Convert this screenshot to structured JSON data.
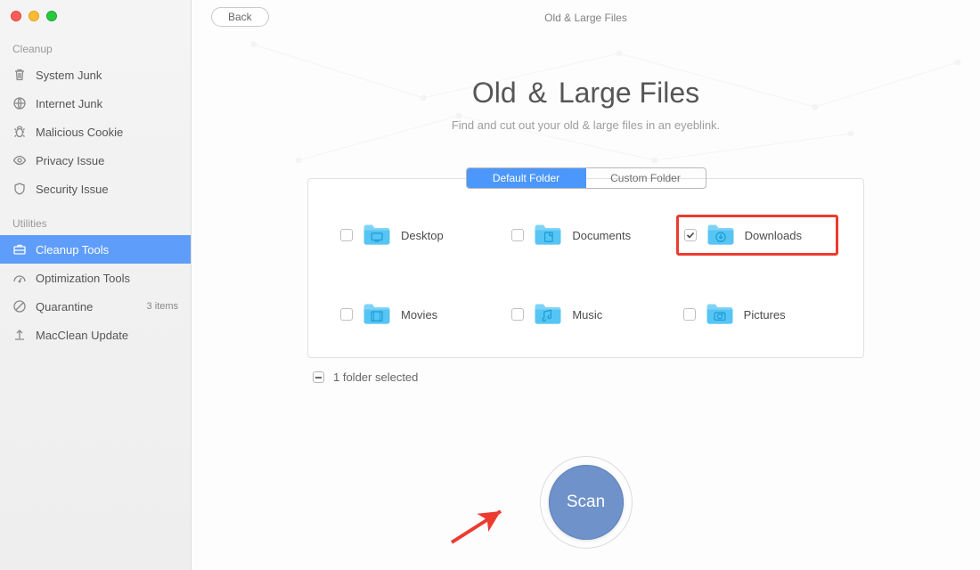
{
  "header": {
    "back_label": "Back",
    "window_title": "Old & Large Files"
  },
  "sidebar": {
    "sections": {
      "cleanup_label": "Cleanup",
      "utilities_label": "Utilities"
    },
    "cleanup": [
      {
        "icon": "trash",
        "label": "System Junk"
      },
      {
        "icon": "globe",
        "label": "Internet Junk"
      },
      {
        "icon": "bug",
        "label": "Malicious Cookie"
      },
      {
        "icon": "eye",
        "label": "Privacy Issue"
      },
      {
        "icon": "shield",
        "label": "Security Issue"
      }
    ],
    "utilities": [
      {
        "icon": "briefcase",
        "label": "Cleanup Tools",
        "active": true
      },
      {
        "icon": "gauge",
        "label": "Optimization Tools"
      },
      {
        "icon": "quarantine",
        "label": "Quarantine",
        "badge": "3 items"
      },
      {
        "icon": "upload",
        "label": "MacClean Update"
      }
    ]
  },
  "hero": {
    "title_pre": "Old ",
    "title_amp": "&",
    "title_post": " Large Files",
    "subtitle": "Find and cut out your old & large files in an eyeblink."
  },
  "tabs": {
    "default": "Default Folder",
    "custom": "Custom Folder"
  },
  "folders": [
    {
      "name": "Desktop",
      "icon": "desktop",
      "checked": false,
      "highlight": false
    },
    {
      "name": "Documents",
      "icon": "documents",
      "checked": false,
      "highlight": false
    },
    {
      "name": "Downloads",
      "icon": "downloads",
      "checked": true,
      "highlight": true
    },
    {
      "name": "Movies",
      "icon": "movies",
      "checked": false,
      "highlight": false
    },
    {
      "name": "Music",
      "icon": "music",
      "checked": false,
      "highlight": false
    },
    {
      "name": "Pictures",
      "icon": "pictures",
      "checked": false,
      "highlight": false
    }
  ],
  "selection": {
    "text": "1 folder selected"
  },
  "scan": {
    "label": "Scan"
  },
  "colors": {
    "accent": "#4c97fb",
    "highlight": "#ec3b2f",
    "scan": "#6e92c9"
  }
}
